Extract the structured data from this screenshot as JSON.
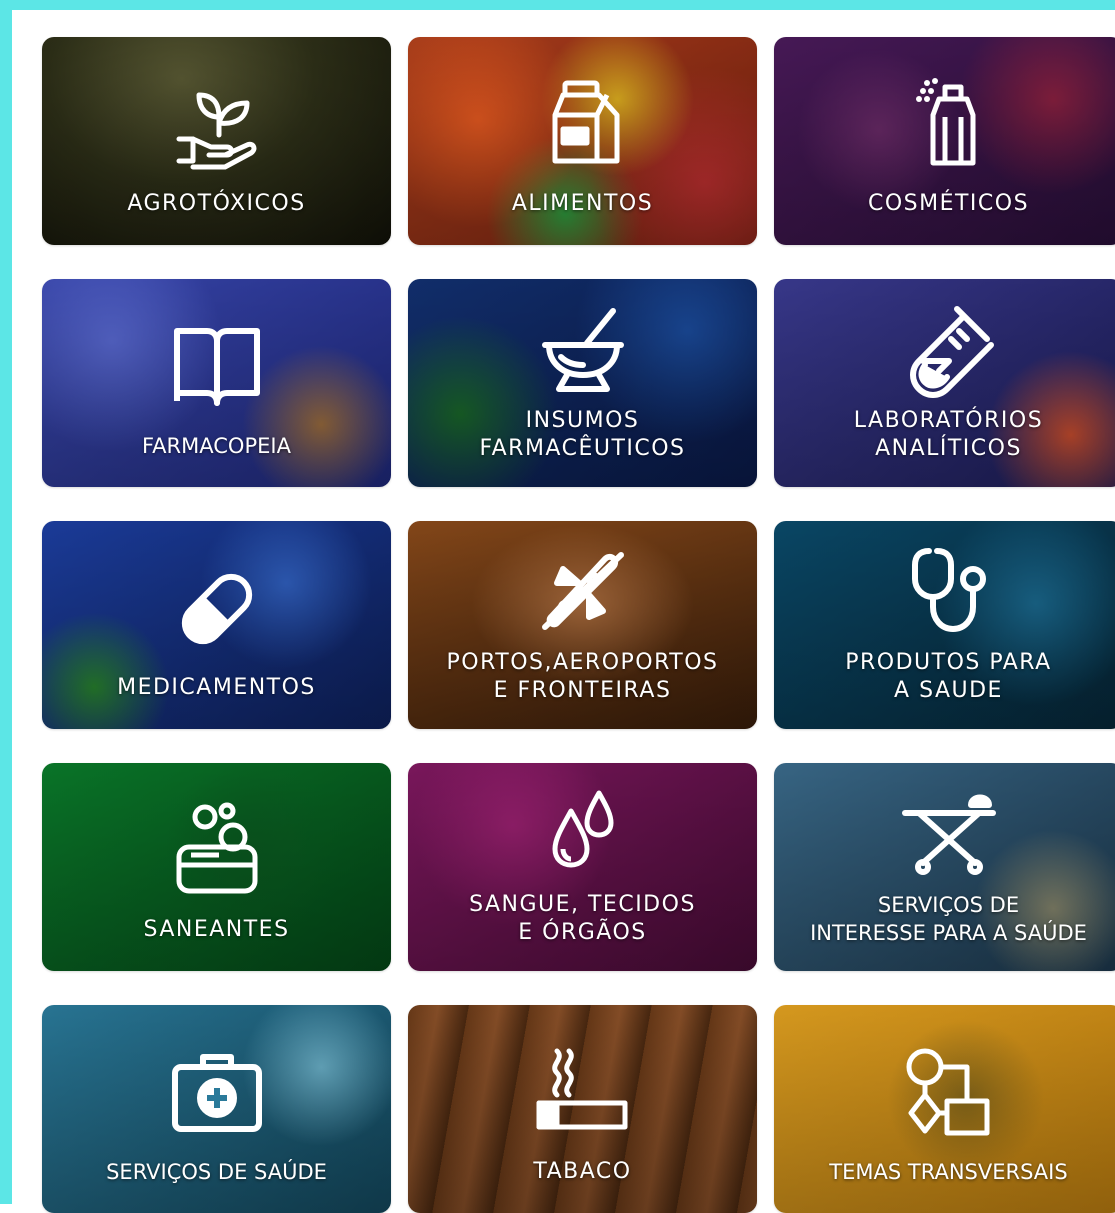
{
  "tiles": [
    {
      "label1": "AGROTÓXICOS",
      "label2": "",
      "icon": "plant-hand-icon"
    },
    {
      "label1": "ALIMENTOS",
      "label2": "",
      "icon": "milk-carton-icon"
    },
    {
      "label1": "COSMÉTICOS",
      "label2": "",
      "icon": "spray-can-icon"
    },
    {
      "label1": "FARMACOPEIA",
      "label2": "",
      "icon": "open-book-icon"
    },
    {
      "label1": "INSUMOS",
      "label2": "FARMACÊUTICOS",
      "icon": "mortar-pestle-icon"
    },
    {
      "label1": "LABORATÓRIOS",
      "label2": "ANALÍTICOS",
      "icon": "test-tube-icon"
    },
    {
      "label1": "MEDICAMENTOS",
      "label2": "",
      "icon": "pill-capsule-icon"
    },
    {
      "label1": "PORTOS,AEROPORTOS",
      "label2": "E FRONTEIRAS",
      "icon": "airplane-icon"
    },
    {
      "label1": "PRODUTOS PARA",
      "label2": "A SAUDE",
      "icon": "stethoscope-icon"
    },
    {
      "label1": "SANEANTES",
      "label2": "",
      "icon": "soap-bubbles-icon"
    },
    {
      "label1": "SANGUE, TECIDOS",
      "label2": "E ÓRGÃOS",
      "icon": "blood-drops-icon"
    },
    {
      "label1": "SERVIÇOS DE",
      "label2": "INTERESSE PARA A SAÚDE",
      "icon": "stretcher-icon"
    },
    {
      "label1": "SERVIÇOS DE SAÚDE",
      "label2": "",
      "icon": "first-aid-kit-icon"
    },
    {
      "label1": "TABACO",
      "label2": "",
      "icon": "cigarette-icon"
    },
    {
      "label1": "TEMAS TRANSVERSAIS",
      "label2": "",
      "icon": "flowchart-icon"
    }
  ],
  "colors": {
    "frame_border": "#5ce6e6",
    "label_text": "#ffffff"
  }
}
